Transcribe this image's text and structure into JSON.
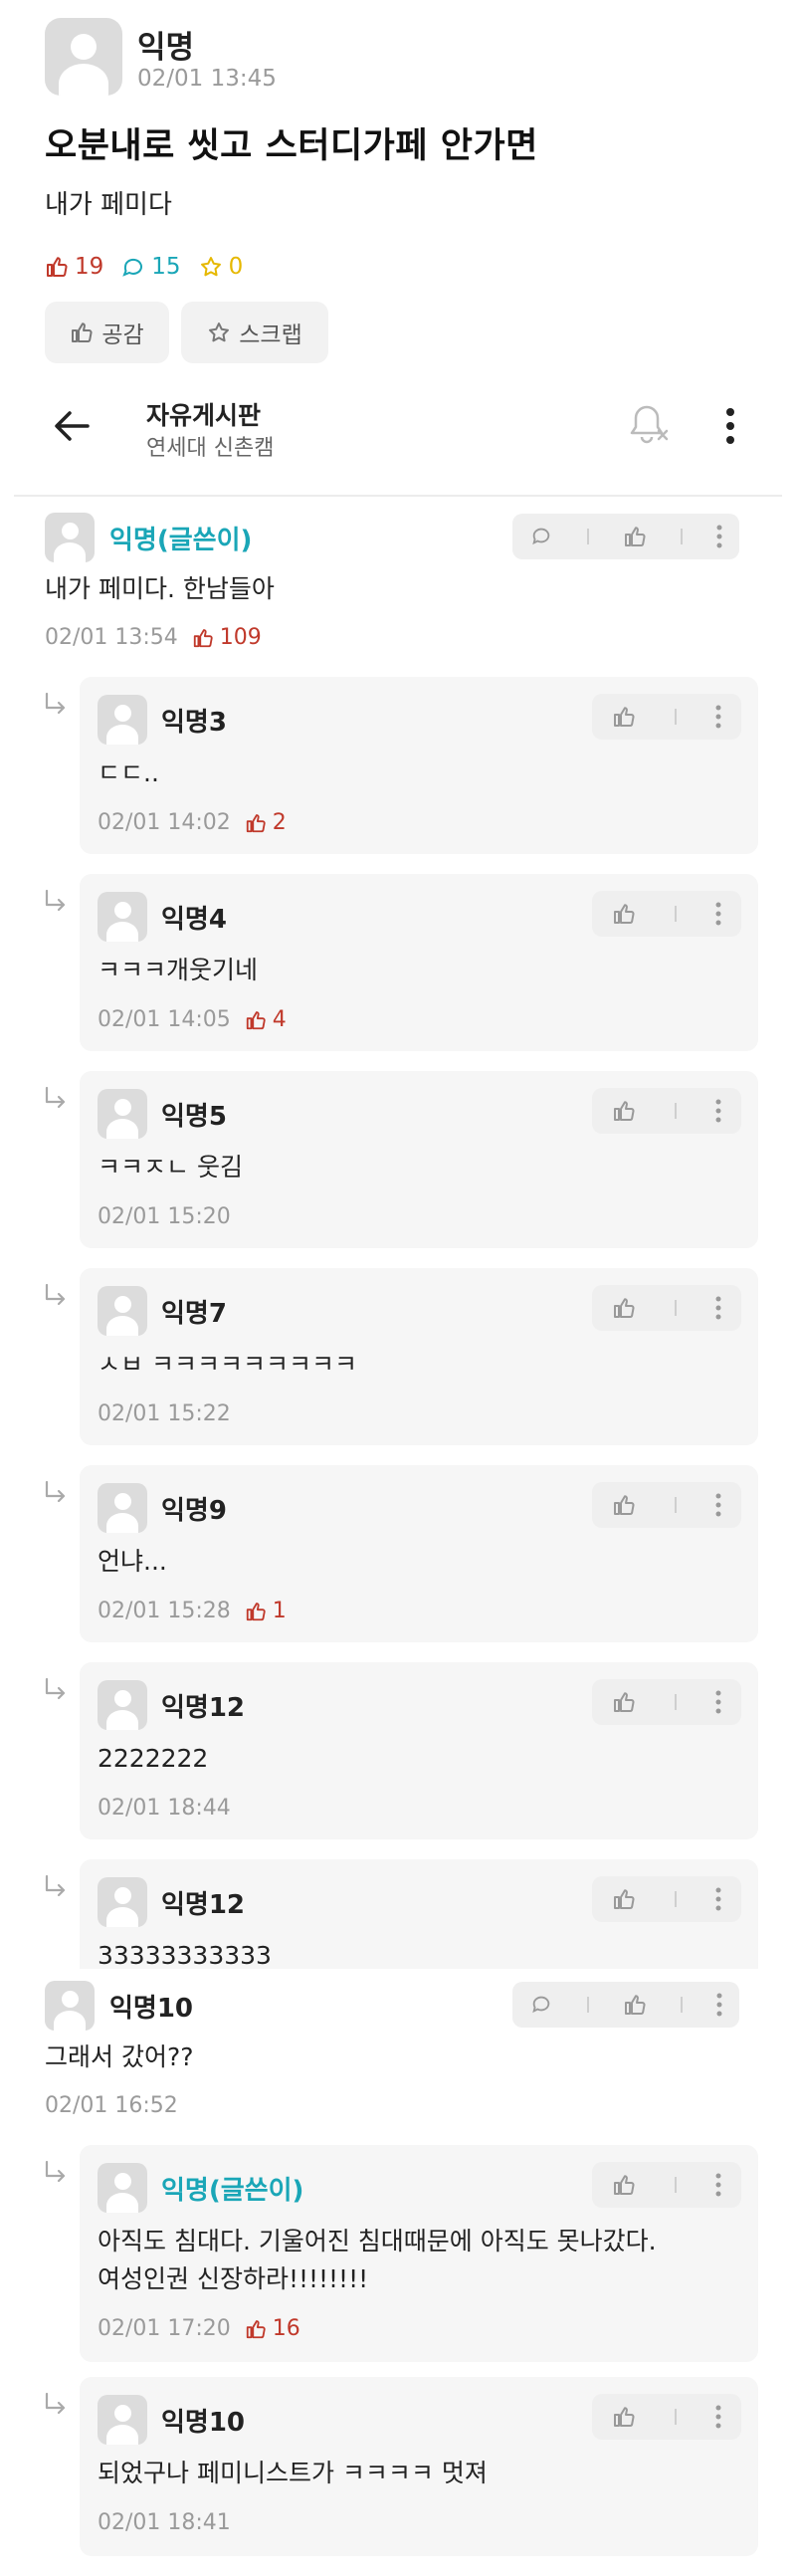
{
  "post": {
    "author": "익명",
    "time": "02/01 13:45",
    "title": "오분내로 씻고 스터디가페 안가면",
    "body": "내가 페미다",
    "likes": "19",
    "comments": "15",
    "scraps": "0",
    "empathy_label": "공감",
    "scrap_label": "스크랩"
  },
  "board": {
    "title": "자유게시판",
    "subtitle": "연세대 신촌캠"
  },
  "colors": {
    "accent_teal": "#1aa6b7",
    "like_red": "#c0392b",
    "scrap_yellow": "#e6b800"
  },
  "comments": [
    {
      "type": "comment",
      "author": "익명(글쓴이)",
      "op": true,
      "text": "내가 페미다. 한남들아",
      "time": "02/01 13:54",
      "likes": "109"
    },
    {
      "type": "reply",
      "author": "익명3",
      "text": "ㄷㄷ..",
      "time": "02/01 14:02",
      "likes": "2"
    },
    {
      "type": "reply",
      "author": "익명4",
      "text": "ㅋㅋㅋ개웃기네",
      "time": "02/01 14:05",
      "likes": "4"
    },
    {
      "type": "reply",
      "author": "익명5",
      "text": "ㅋㅋㅈㄴ 웃김",
      "time": "02/01 15:20",
      "likes": ""
    },
    {
      "type": "reply",
      "author": "익명7",
      "text": "ㅅㅂ ㅋㅋㅋㅋㅋㅋㅋㅋㅋ",
      "time": "02/01 15:22",
      "likes": ""
    },
    {
      "type": "reply",
      "author": "익명9",
      "text": "언냐...",
      "time": "02/01 15:28",
      "likes": "1"
    },
    {
      "type": "reply",
      "author": "익명12",
      "text": "2222222",
      "time": "02/01 18:44",
      "likes": ""
    },
    {
      "type": "reply",
      "author": "익명12",
      "text": "33333333333",
      "time": "",
      "likes": ""
    },
    {
      "type": "comment",
      "author": "익명10",
      "op": false,
      "text": "그래서 갔어??",
      "time": "02/01 16:52",
      "likes": ""
    },
    {
      "type": "reply",
      "author": "익명(글쓴이)",
      "op": true,
      "text": "아직도 침대다. 기울어진 침대때문에 아직도 못나갔다.\n여성인권 신장하라!!!!!!!!",
      "time": "02/01 17:20",
      "likes": "16"
    },
    {
      "type": "reply",
      "author": "익명10",
      "text": "되었구나 페미니스트가 ㅋㅋㅋㅋ 멋져",
      "time": "02/01 18:41",
      "likes": ""
    }
  ]
}
